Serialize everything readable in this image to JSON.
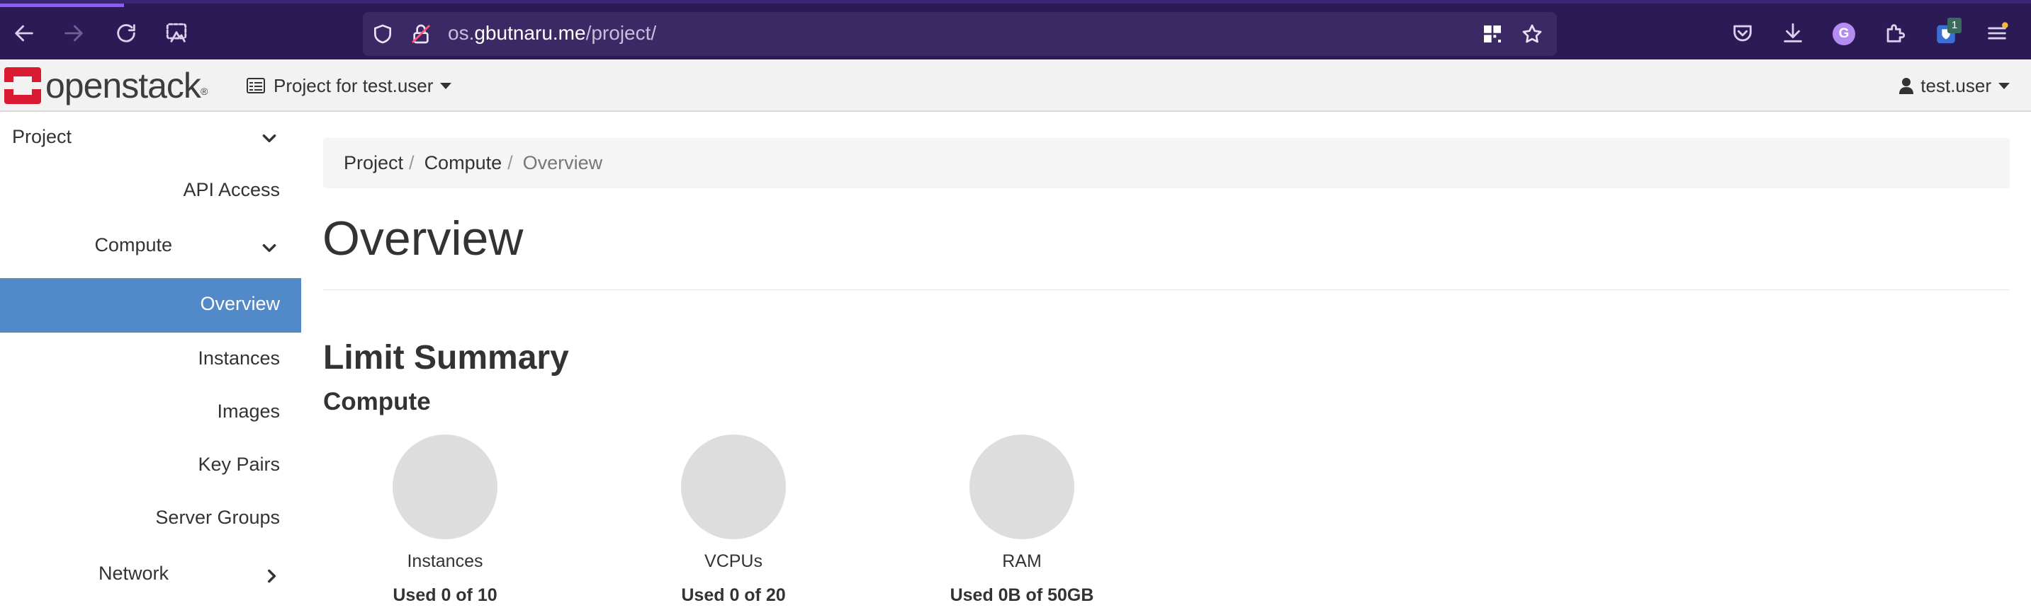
{
  "browser": {
    "url_host": "os.",
    "url_domain": "gbutnaru.me",
    "url_path": "/project/",
    "profile_initial": "G",
    "extension_badge": "1",
    "icons": [
      "back-arrow-icon",
      "forward-arrow-icon",
      "reload-icon",
      "customize-icon",
      "shield-icon",
      "lock-icon",
      "qr-code-icon",
      "star-icon",
      "pocket-icon",
      "download-icon",
      "extensions-icon",
      "bitwarden-icon",
      "menu-icon"
    ],
    "accent_color": "#2b1a56"
  },
  "header": {
    "logo_text": "openstack",
    "logo_mark": "®",
    "project_switcher": "Project for test.user",
    "user_menu": "test.user"
  },
  "sidebar": {
    "project": "Project",
    "api_access": "API Access",
    "compute": "Compute",
    "overview": "Overview",
    "instances": "Instances",
    "images": "Images",
    "key_pairs": "Key Pairs",
    "server_groups": "Server Groups",
    "network": "Network",
    "active_color": "#5289c9"
  },
  "breadcrumb": {
    "items": [
      "Project",
      "Compute",
      "Overview"
    ],
    "separator": "/"
  },
  "main": {
    "title": "Overview",
    "limit_summary": "Limit Summary",
    "compute_heading": "Compute",
    "charts": [
      {
        "label": "Instances",
        "used": "Used 0 of 10"
      },
      {
        "label": "VCPUs",
        "used": "Used 0 of 20"
      },
      {
        "label": "RAM",
        "used": "Used 0B of 50GB"
      }
    ]
  }
}
